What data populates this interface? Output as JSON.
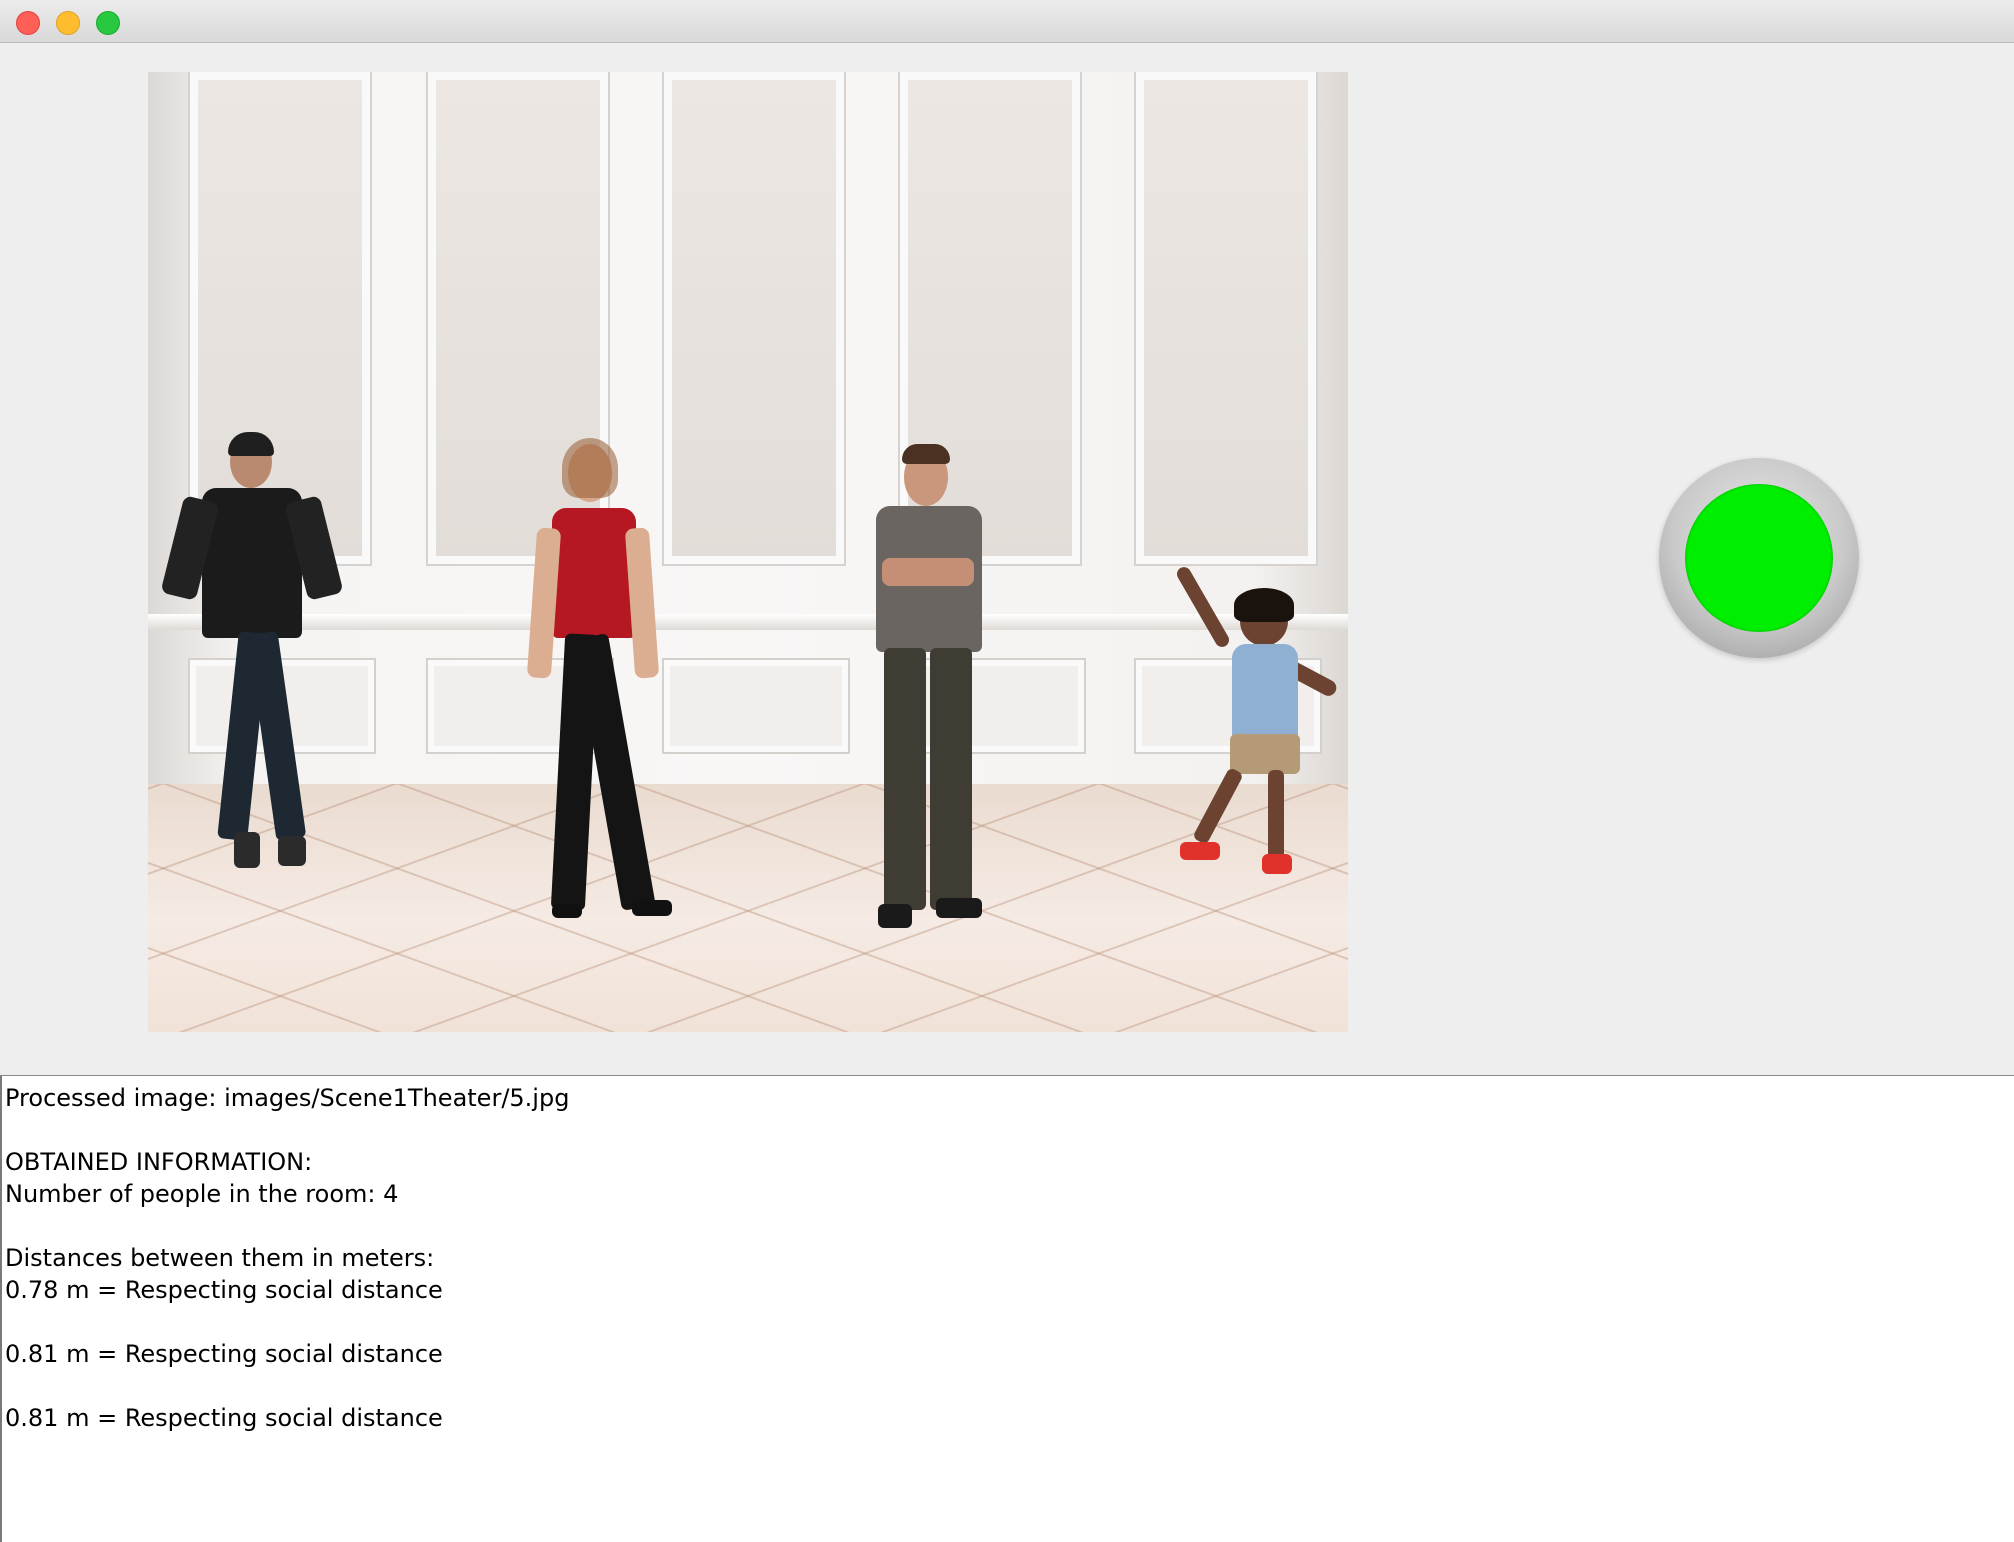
{
  "window": {
    "buttons": [
      "close",
      "minimize",
      "zoom"
    ]
  },
  "scene": {
    "description_icon": "scene-image",
    "people_count": 4
  },
  "status": {
    "color": "#00ee00",
    "state": "safe"
  },
  "log": {
    "lines": [
      "Processed image: images/Scene1Theater/5.jpg",
      "",
      "OBTAINED INFORMATION:",
      "Number of people in the room: 4",
      "",
      "Distances between them in meters:",
      "0.78 m = Respecting social distance",
      "",
      "0.81 m = Respecting social distance",
      "",
      "0.81 m = Respecting social distance"
    ]
  }
}
